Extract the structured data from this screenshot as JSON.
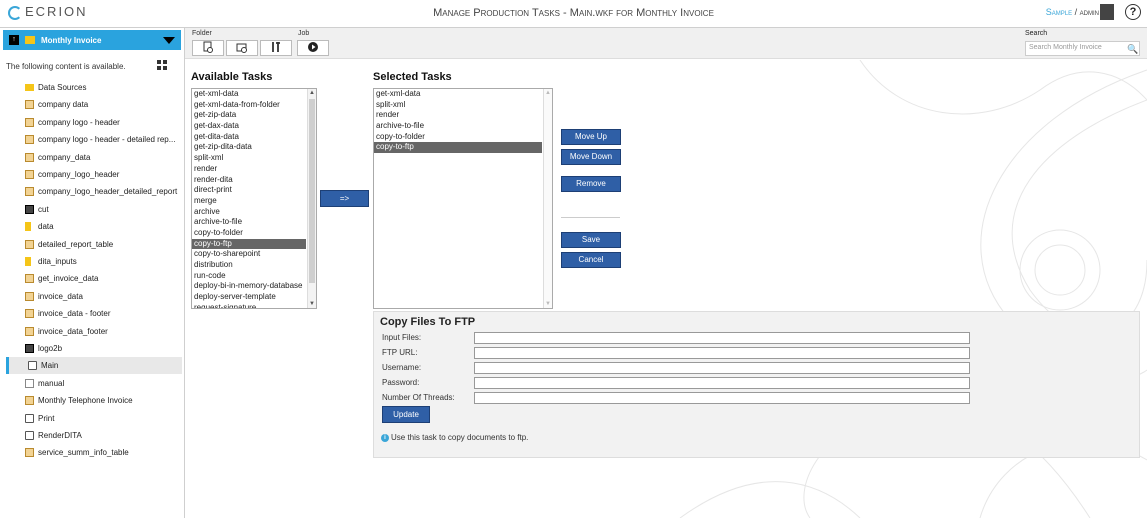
{
  "header": {
    "logo": "ECRION",
    "title": "Manage Production Tasks - Main.wkf for Monthly Invoice",
    "user_sample": "Sample",
    "user_sep": " / ",
    "user_name": "admin",
    "help": "?"
  },
  "sidebar": {
    "project": "Monthly Invoice",
    "info": "The following content is available.",
    "items": [
      {
        "label": "Data Sources",
        "icon": "folder-icon"
      },
      {
        "label": "company data",
        "icon": "document-icon"
      },
      {
        "label": "company logo - header",
        "icon": "document-icon"
      },
      {
        "label": "company logo - header - detailed rep...",
        "icon": "document-icon"
      },
      {
        "label": "company_data",
        "icon": "document-icon"
      },
      {
        "label": "company_logo_header",
        "icon": "document-icon"
      },
      {
        "label": "company_logo_header_detailed_report",
        "icon": "document-icon"
      },
      {
        "label": "cut",
        "icon": "image-icon"
      },
      {
        "label": "data",
        "icon": "data-icon"
      },
      {
        "label": "detailed_report_table",
        "icon": "document-icon"
      },
      {
        "label": "dita_inputs",
        "icon": "data-icon"
      },
      {
        "label": "get_invoice_data",
        "icon": "document-icon"
      },
      {
        "label": "invoice_data",
        "icon": "document-icon"
      },
      {
        "label": "invoice_data - footer",
        "icon": "document-icon"
      },
      {
        "label": "invoice_data_footer",
        "icon": "document-icon"
      },
      {
        "label": "logo2b",
        "icon": "image-icon"
      },
      {
        "label": "Main",
        "icon": "workflow-icon",
        "selected": true
      },
      {
        "label": "manual",
        "icon": "file-icon"
      },
      {
        "label": "Monthly Telephone Invoice",
        "icon": "document-icon"
      },
      {
        "label": "Print",
        "icon": "workflow-icon"
      },
      {
        "label": "RenderDITA",
        "icon": "workflow-icon"
      },
      {
        "label": "service_summ_info_table",
        "icon": "document-icon"
      }
    ]
  },
  "toolbar": {
    "folder_label": "Folder",
    "job_label": "Job",
    "search_label": "Search",
    "search_placeholder": "Search Monthly Invoice"
  },
  "available": {
    "title": "Available Tasks",
    "items": [
      "get-xml-data",
      "get-xml-data-from-folder",
      "get-zip-data",
      "get-dax-data",
      "get-dita-data",
      "get-zip-dita-data",
      "split-xml",
      "render",
      "render-dita",
      "direct-print",
      "merge",
      "archive",
      "archive-to-file",
      "copy-to-folder",
      "copy-to-ftp",
      "copy-to-sharepoint",
      "distribution",
      "run-code",
      "deploy-bi-in-memory-database",
      "deploy-server-template",
      "request-signature"
    ],
    "selected_index": 14
  },
  "add_button": "=>",
  "selected": {
    "title": "Selected Tasks",
    "items": [
      "get-xml-data",
      "split-xml",
      "render",
      "archive-to-file",
      "copy-to-folder",
      "copy-to-ftp"
    ],
    "selected_index": 5
  },
  "actions": {
    "move_up": "Move Up",
    "move_down": "Move Down",
    "remove": "Remove",
    "save": "Save",
    "cancel": "Cancel"
  },
  "form": {
    "title": "Copy Files To FTP",
    "fields": [
      {
        "label": "Input Files:",
        "value": ""
      },
      {
        "label": "FTP URL:",
        "value": ""
      },
      {
        "label": "Username:",
        "value": ""
      },
      {
        "label": "Password:",
        "value": ""
      },
      {
        "label": "Number Of Threads:",
        "value": ""
      }
    ],
    "update": "Update",
    "info": "Use this task to copy documents to ftp."
  },
  "colors": {
    "accent": "#2aa3de",
    "button": "#2f5fa6",
    "selection": "#666666"
  }
}
